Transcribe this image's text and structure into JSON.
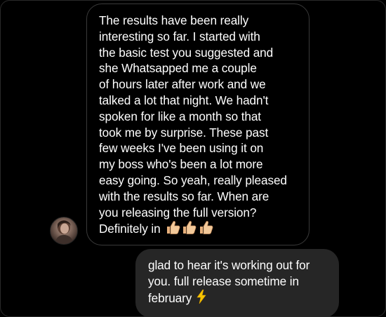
{
  "conversation": {
    "incoming": {
      "text": "The results have been really\ninteresting so far. I started with\nthe basic test you suggested and\nshe Whatsapped me a couple\nof hours later after work and we\ntalked a lot that night. We hadn't\nspoken for like a month so that\ntook me by surprise. These past\nfew weeks I've been using it on\nmy boss who's been a lot more\neasy going. So yeah, really pleased\nwith the results so far. When are\nyou releasing the full version?\nDefinitely in",
      "emoji": "thumbs-up-icon x3",
      "bubble_border_color": "#3a3a3a"
    },
    "outgoing": {
      "text": "glad to hear it's working out for\nyou. full release sometime in\nfebruary",
      "emoji": "lightning-bolt-icon",
      "bubble_color": "#262626"
    }
  },
  "colors": {
    "background": "#000000",
    "text": "#ffffff",
    "bolt": "#f5c400",
    "thumb": "#f2c99a"
  }
}
